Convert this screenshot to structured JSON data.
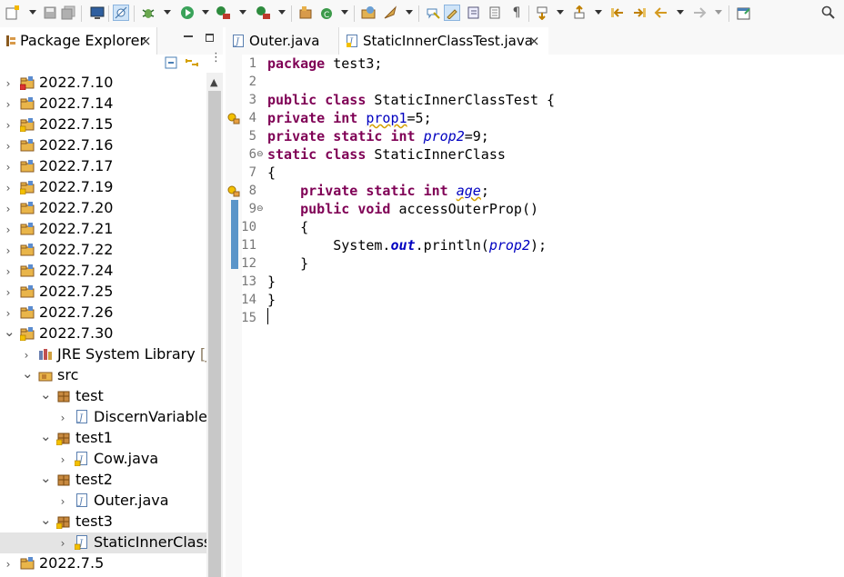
{
  "toolbar": {
    "icons": [
      "new-icon",
      "save-icon",
      "save-all-icon",
      "terminal-icon",
      "skip-breakpoints-icon",
      "debug-icon",
      "run-icon",
      "coverage-icon",
      "external-tools-icon",
      "new-java-project-icon",
      "new-java-class-icon",
      "open-type-icon",
      "open-task-icon",
      "toggle-mark-occurrences-icon",
      "toggle-block-selection-icon",
      "show-whitespace-icon",
      "next-annotation-icon",
      "previous-annotation-icon",
      "last-edit-location-icon",
      "back-icon",
      "forward-icon",
      "maximize-icon",
      "search-icon"
    ]
  },
  "explorer": {
    "title": "Package Explorer",
    "close_glyph": "×",
    "tree": [
      {
        "label": "2022.7.10",
        "state": "collapsed",
        "icon": "project-error-icon"
      },
      {
        "label": "2022.7.14",
        "state": "collapsed",
        "icon": "project-icon"
      },
      {
        "label": "2022.7.15",
        "state": "collapsed",
        "icon": "project-warning-icon"
      },
      {
        "label": "2022.7.16",
        "state": "collapsed",
        "icon": "project-icon"
      },
      {
        "label": "2022.7.17",
        "state": "collapsed",
        "icon": "project-icon"
      },
      {
        "label": "2022.7.19",
        "state": "collapsed",
        "icon": "project-warning-icon"
      },
      {
        "label": "2022.7.20",
        "state": "collapsed",
        "icon": "project-icon"
      },
      {
        "label": "2022.7.21",
        "state": "collapsed",
        "icon": "project-icon"
      },
      {
        "label": "2022.7.22",
        "state": "collapsed",
        "icon": "project-icon"
      },
      {
        "label": "2022.7.24",
        "state": "collapsed",
        "icon": "project-icon"
      },
      {
        "label": "2022.7.25",
        "state": "collapsed",
        "icon": "project-icon"
      },
      {
        "label": "2022.7.26",
        "state": "collapsed",
        "icon": "project-icon"
      },
      {
        "label": "2022.7.30",
        "state": "expanded",
        "icon": "project-warning-icon"
      },
      {
        "label": "JRE System Library",
        "suffix": "[Jav",
        "state": "collapsed",
        "icon": "library-icon"
      },
      {
        "label": "src",
        "state": "expanded",
        "icon": "source-folder-icon"
      },
      {
        "label": "test",
        "state": "expanded",
        "icon": "package-icon"
      },
      {
        "label": "DiscernVariable.j",
        "state": "collapsed",
        "icon": "java-file-icon"
      },
      {
        "label": "test1",
        "state": "expanded",
        "icon": "package-warning-icon"
      },
      {
        "label": "Cow.java",
        "state": "collapsed",
        "icon": "java-file-warning-icon"
      },
      {
        "label": "test2",
        "state": "expanded",
        "icon": "package-icon"
      },
      {
        "label": "Outer.java",
        "state": "collapsed",
        "icon": "java-file-icon"
      },
      {
        "label": "test3",
        "state": "expanded",
        "icon": "package-warning-icon"
      },
      {
        "label": "StaticInnerClassT",
        "state": "collapsed",
        "icon": "java-file-warning-icon",
        "selected": true
      },
      {
        "label": "2022.7.5",
        "state": "collapsed",
        "icon": "project-icon"
      }
    ]
  },
  "editor": {
    "tabs": [
      {
        "label": "Outer.java",
        "active": false
      },
      {
        "label": "StaticInnerClassTest.java",
        "active": true,
        "close_glyph": "×"
      }
    ],
    "line_numbers": [
      "1",
      "2",
      "3",
      "4",
      "5",
      "6",
      "7",
      "8",
      "9",
      "10",
      "11",
      "12",
      "13",
      "14",
      "15"
    ],
    "code": {
      "l1_kw": "package",
      "l1_rest": " test3;",
      "l3_kw1": "public",
      "l3_kw2": "class",
      "l3_rest": " StaticInnerClassTest {",
      "l4_kw1": "private",
      "l4_kw2": "int",
      "l4_field": "prop1",
      "l4_rest": "=5;",
      "l5_kw1": "private",
      "l5_kw2": "static",
      "l5_kw3": "int",
      "l5_field": "prop2",
      "l5_rest": "=9;",
      "l6_kw1": "static",
      "l6_kw2": "class",
      "l6_rest": " StaticInnerClass",
      "l7": "{",
      "l8_kw1": "private",
      "l8_kw2": "static",
      "l8_kw3": "int",
      "l8_field": "age",
      "l8_rest": ";",
      "l9_kw1": "public",
      "l9_kw2": "void",
      "l9_rest": " accessOuterProp()",
      "l10": "{",
      "l11_a": "System.",
      "l11_out": "out",
      "l11_b": ".println(",
      "l11_field": "prop2",
      "l11_c": ");",
      "l12": "}",
      "l13": "}",
      "l14": "}"
    }
  }
}
